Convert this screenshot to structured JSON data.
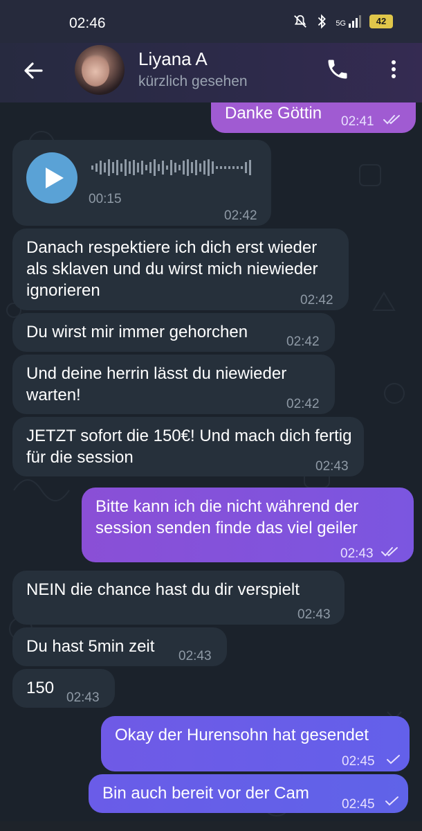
{
  "status_bar": {
    "time": "02:46",
    "network": "5G",
    "battery": "42"
  },
  "header": {
    "contact_name": "Liyana A",
    "contact_status": "kürzlich gesehen"
  },
  "messages": [
    {
      "direction": "out",
      "text": "Danke Göttin",
      "time": "02:41",
      "read": true
    },
    {
      "direction": "in",
      "type": "voice",
      "duration": "00:15",
      "time": "02:42"
    },
    {
      "direction": "in",
      "text": "Danach respektiere ich dich erst wieder als sklaven und du wirst mich niewieder ignorieren",
      "time": "02:42"
    },
    {
      "direction": "in",
      "text": "Du wirst mir immer gehorchen",
      "time": "02:42"
    },
    {
      "direction": "in",
      "text": "Und deine herrin lässt du niewieder warten!",
      "time": "02:42"
    },
    {
      "direction": "in",
      "text": "JETZT sofort die 150€! Und mach dich fertig für die session",
      "time": "02:43"
    },
    {
      "direction": "out",
      "text": "Bitte kann ich die nicht während der session senden finde das viel geiler",
      "time": "02:43",
      "read": true
    },
    {
      "direction": "in",
      "text": "NEIN die chance hast du dir verspielt",
      "time": "02:43"
    },
    {
      "direction": "in",
      "text": "Du hast 5min zeit",
      "time": "02:43"
    },
    {
      "direction": "in",
      "text": "150",
      "time": "02:43"
    },
    {
      "direction": "out",
      "text": "Okay der Hurensohn hat gesendet",
      "time": "02:45",
      "read": false
    },
    {
      "direction": "out",
      "text": "Bin auch bereit vor der Cam",
      "time": "02:45",
      "read": false
    }
  ],
  "colors": {
    "incoming_bubble": "#26303b",
    "outgoing_gradient_start": "#8a4fd6",
    "outgoing_gradient_end": "#5f63e8",
    "background": "#1b222b"
  }
}
